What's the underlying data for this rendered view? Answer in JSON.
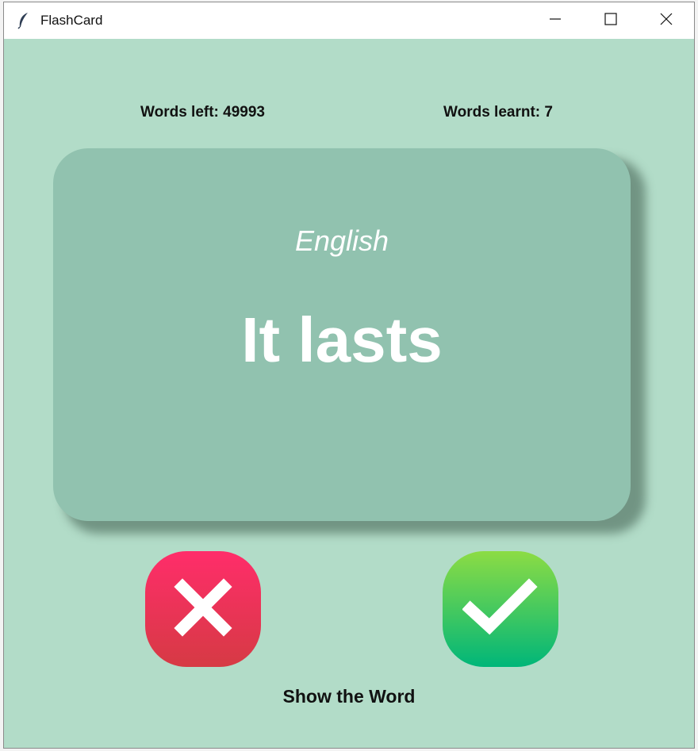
{
  "window": {
    "title": "FlashCard",
    "app_icon": "feather-icon",
    "controls": [
      "minimize-icon",
      "maximize-icon",
      "close-icon"
    ]
  },
  "stats": {
    "words_left": "Words left: 49993",
    "words_learnt": "Words learnt: 7"
  },
  "card": {
    "language": "English",
    "word": "It lasts"
  },
  "actions": {
    "wrong_icon": "cross-icon",
    "right_icon": "check-icon",
    "show_word_label": "Show the Word"
  },
  "colors": {
    "background": "#b2dcc8",
    "card": "#91c2af",
    "wrong_button": "#ff2d6a",
    "right_button": "#00b679"
  }
}
